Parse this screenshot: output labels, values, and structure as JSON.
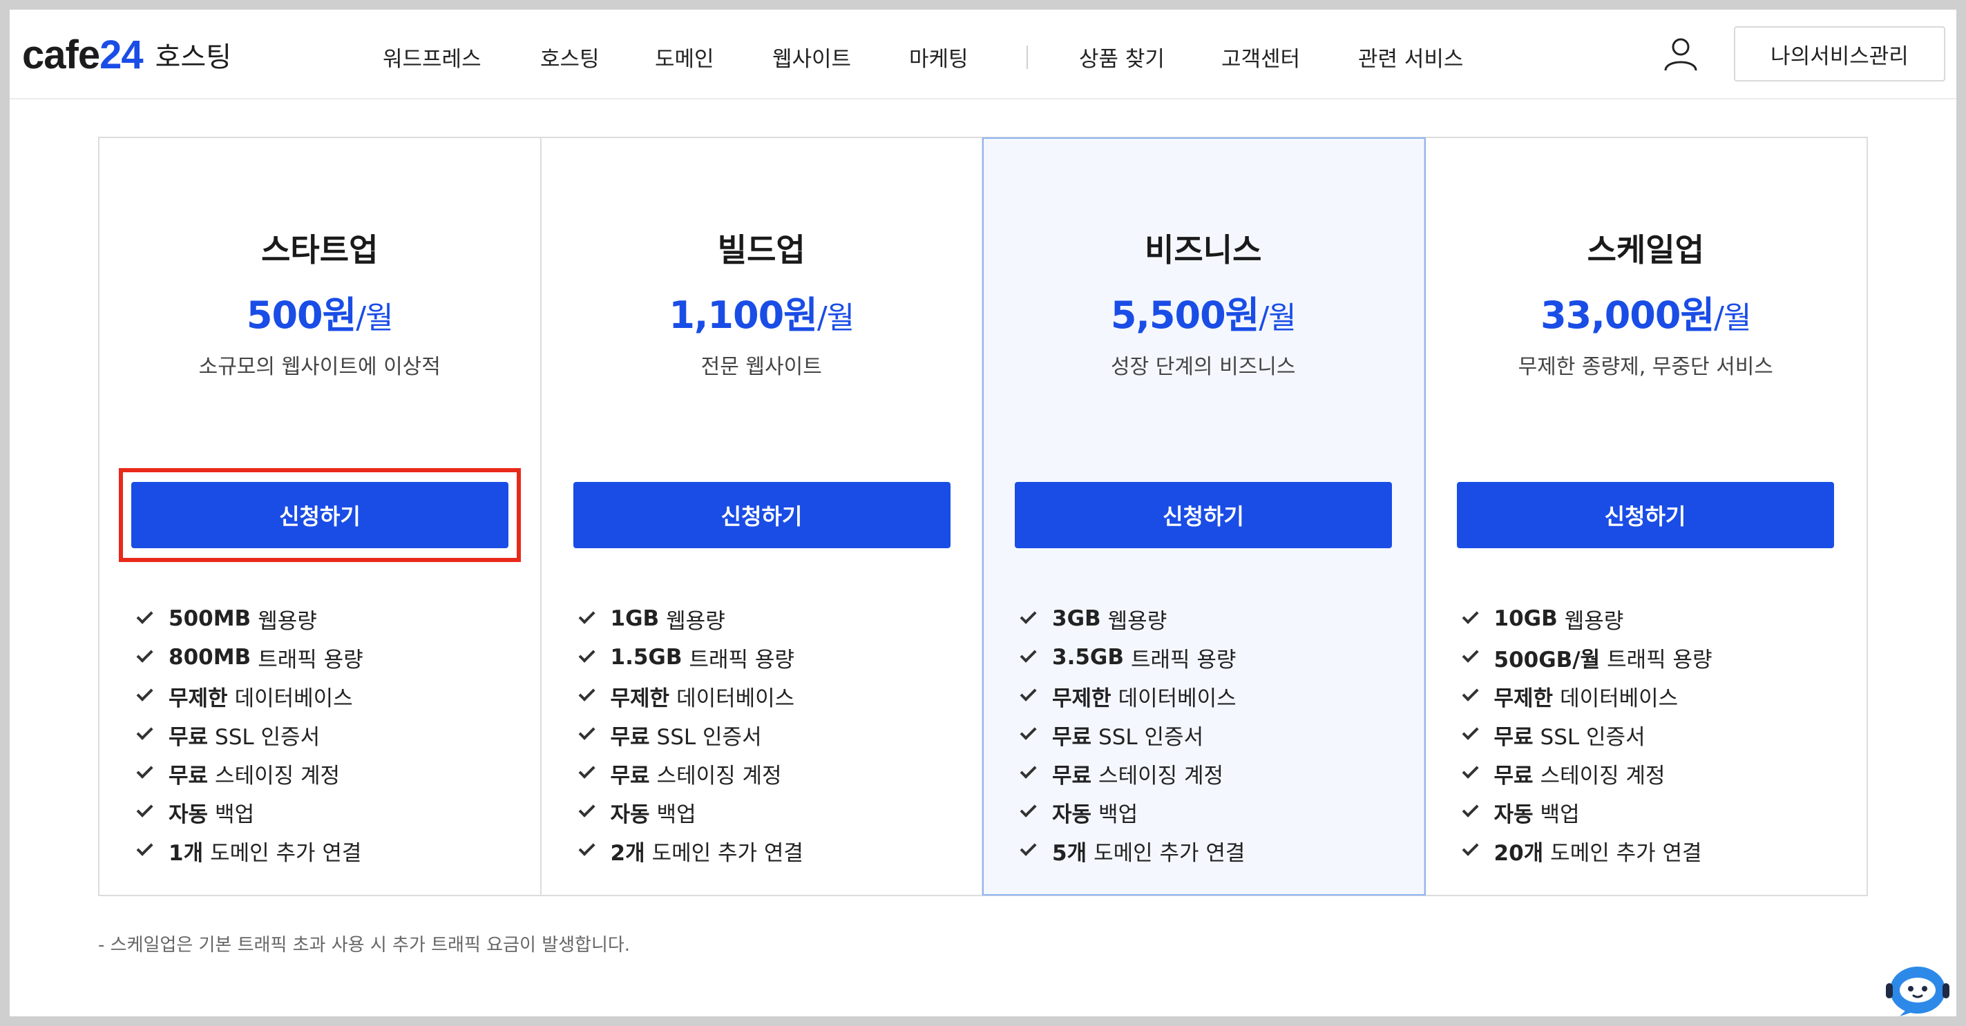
{
  "header": {
    "logo_left": "cafe",
    "logo_accent": "24",
    "logo_sub": "호스팅",
    "nav": [
      "워드프레스",
      "호스팅",
      "도메인",
      "웹사이트",
      "마케팅",
      "상품 찾기",
      "고객센터",
      "관련 서비스"
    ],
    "manage_label": "나의서비스관리"
  },
  "plans": [
    {
      "name": "스타트업",
      "price": "500원",
      "unit": "/월",
      "desc": "소규모의 웹사이트에 이상적",
      "button": "신청하기",
      "features": [
        {
          "bold": "500MB",
          "text": "웹용량"
        },
        {
          "bold": "800MB",
          "text": "트래픽 용량"
        },
        {
          "bold": "무제한",
          "text": "데이터베이스"
        },
        {
          "bold": "무료",
          "text": "SSL 인증서"
        },
        {
          "bold": "무료",
          "text": "스테이징 계정"
        },
        {
          "bold": "자동",
          "text": "백업"
        },
        {
          "bold": "1개",
          "text": "도메인 추가 연결"
        }
      ]
    },
    {
      "name": "빌드업",
      "price": "1,100원",
      "unit": "/월",
      "desc": "전문 웹사이트",
      "button": "신청하기",
      "features": [
        {
          "bold": "1GB",
          "text": "웹용량"
        },
        {
          "bold": "1.5GB",
          "text": "트래픽 용량"
        },
        {
          "bold": "무제한",
          "text": "데이터베이스"
        },
        {
          "bold": "무료",
          "text": "SSL 인증서"
        },
        {
          "bold": "무료",
          "text": "스테이징 계정"
        },
        {
          "bold": "자동",
          "text": "백업"
        },
        {
          "bold": "2개",
          "text": "도메인 추가 연결"
        }
      ]
    },
    {
      "name": "비즈니스",
      "price": "5,500원",
      "unit": "/월",
      "desc": "성장 단계의 비즈니스",
      "button": "신청하기",
      "features": [
        {
          "bold": "3GB",
          "text": "웹용량"
        },
        {
          "bold": "3.5GB",
          "text": "트래픽 용량"
        },
        {
          "bold": "무제한",
          "text": "데이터베이스"
        },
        {
          "bold": "무료",
          "text": "SSL 인증서"
        },
        {
          "bold": "무료",
          "text": "스테이징 계정"
        },
        {
          "bold": "자동",
          "text": "백업"
        },
        {
          "bold": "5개",
          "text": "도메인 추가 연결"
        }
      ]
    },
    {
      "name": "스케일업",
      "price": "33,000원",
      "unit": "/월",
      "desc": "무제한 종량제, 무중단 서비스",
      "button": "신청하기",
      "features": [
        {
          "bold": "10GB",
          "text": "웹용량"
        },
        {
          "bold": "500GB/월",
          "text": "트래픽 용량"
        },
        {
          "bold": "무제한",
          "text": "데이터베이스"
        },
        {
          "bold": "무료",
          "text": "SSL 인증서"
        },
        {
          "bold": "무료",
          "text": "스테이징 계정"
        },
        {
          "bold": "자동",
          "text": "백업"
        },
        {
          "bold": "20개",
          "text": "도메인 추가 연결"
        }
      ]
    }
  ],
  "footnote": "- 스케일업은 기본 트래픽 초과 사용 시 추가 트래픽 요금이 발생합니다.",
  "colors": {
    "accent": "#1a4de6",
    "focus_outline": "#e8291a",
    "highlight_bg": "#f4f8fe"
  },
  "icons": {
    "user": "user-icon",
    "check": "check-icon",
    "chatbot": "chatbot-icon"
  }
}
